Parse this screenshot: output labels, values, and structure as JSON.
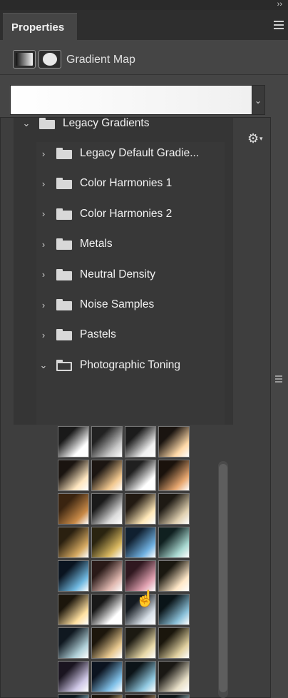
{
  "window": {
    "collapse_glyph": "››",
    "tab_label": "Properties"
  },
  "adjustment": {
    "title": "Gradient Map",
    "dropdown_glyph": "⌄"
  },
  "popup": {
    "parent_folder": "Legacy Gradients",
    "folders": [
      {
        "label": "Legacy Default Gradie...",
        "expanded": false
      },
      {
        "label": "Color Harmonies 1",
        "expanded": false
      },
      {
        "label": "Color Harmonies 2",
        "expanded": false
      },
      {
        "label": "Metals",
        "expanded": false
      },
      {
        "label": "Neutral Density",
        "expanded": false
      },
      {
        "label": "Noise Samples",
        "expanded": false
      },
      {
        "label": "Pastels",
        "expanded": false
      },
      {
        "label": "Photographic Toning",
        "expanded": true
      }
    ],
    "swatch_colors": [
      [
        "#ffffff",
        "#c8c8c8",
        "#f0f0f0",
        "#ffd9a8"
      ],
      [
        "#ffe7c0",
        "#f2c890",
        "#ffffff",
        "#e8a870"
      ],
      [
        "#c98a48",
        "#dcdcdc",
        "#ffe8b8",
        "#e0d0b0"
      ],
      [
        "#d4a860",
        "#d8b860",
        "#6fb0e0",
        "#a8d8d0"
      ],
      [
        "#6fb8e0",
        "#e0b8b0",
        "#e0a0b0",
        "#ffe8c8"
      ],
      [
        "#ffe0a0",
        "#ffffff",
        "#d8e0e8",
        "#8ac0d8"
      ],
      [
        "#b0d0d8",
        "#e8c890",
        "#e8d8a8",
        "#e0d0a0"
      ],
      [
        "#d0c8e8",
        "#80c0e8",
        "#90c8e0",
        "#e8e0c8"
      ],
      [
        "#a8d8e8",
        "#e8c890",
        "#c8a878",
        "#b8d8e0"
      ]
    ],
    "swatch_bases": [
      [
        "#1a1a1a",
        "#222222",
        "#1c1c1c",
        "#1a1410"
      ],
      [
        "#1a1410",
        "#1c1612",
        "#202020",
        "#1a120c"
      ],
      [
        "#3a2410",
        "#1a1a1a",
        "#221a12",
        "#1e1a14"
      ],
      [
        "#2a2010",
        "#2a2410",
        "#102030",
        "#102020"
      ],
      [
        "#0a1420",
        "#2a1a18",
        "#301820",
        "#1a1810"
      ],
      [
        "#1c160c",
        "#181818",
        "#141a20",
        "#0a1418"
      ],
      [
        "#101820",
        "#1c160c",
        "#1c1a12",
        "#1a160c"
      ],
      [
        "#1a1420",
        "#0c1420",
        "#0c1418",
        "#1a1814"
      ],
      [
        "#0c161c",
        "#1c160c",
        "#1a1410",
        "#0e1618"
      ]
    ]
  },
  "icons": {
    "gear": "⚙",
    "gear_caret": "▾",
    "chevron_right": "›",
    "chevron_down": "⌄",
    "pointer": "☝"
  }
}
